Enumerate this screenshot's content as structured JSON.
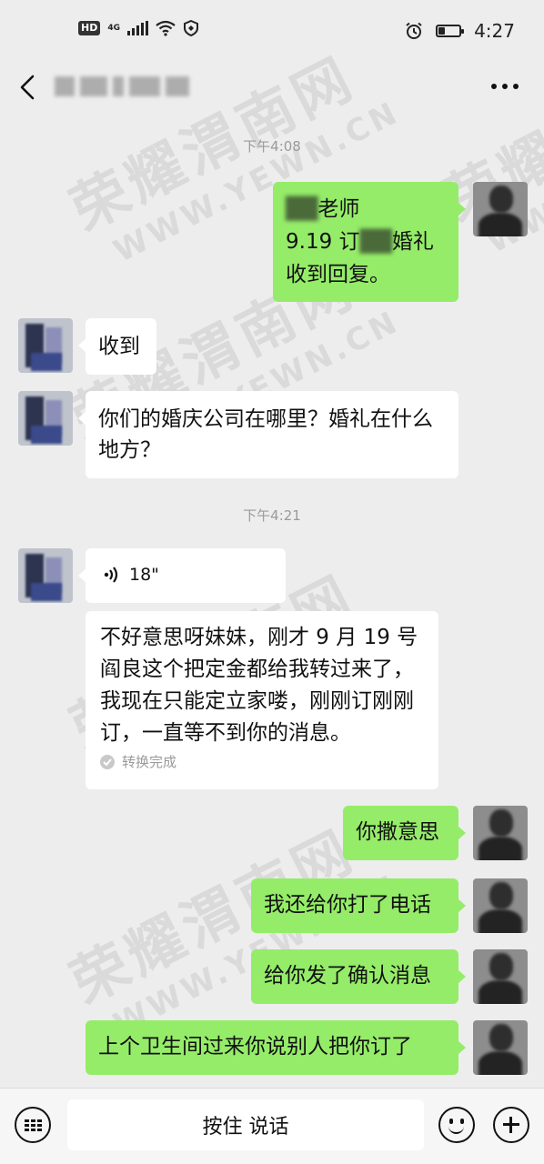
{
  "status_bar": {
    "hd_label": "HD",
    "network_label": "4G",
    "time": "4:27",
    "battery_level": 0.3,
    "icons": [
      "signal-icon",
      "wifi-icon",
      "shield-icon",
      "alarm-icon",
      "battery-icon"
    ]
  },
  "nav": {
    "back_icon": "chevron-left-icon",
    "more_icon": "more-dots-icon"
  },
  "chat": {
    "timestamp_1": "下午4:08",
    "timestamp_2": "下午4:21",
    "msg_self_1": {
      "line1_suffix": "老师",
      "line2_prefix": "9.19 订",
      "line2_suffix": "婚礼",
      "line3": "收到回复。"
    },
    "msg_other_1": "收到",
    "msg_other_2": "你们的婚庆公司在哪里？婚礼在什么地方？",
    "voice": {
      "duration": "18\"",
      "transcript": "不好意思呀妹妹，刚才 9 月 19 号阎良这个把定金都给我转过来了，我现在只能定立家喽，刚刚订刚刚订，一直等不到你的消息。",
      "status": "转换完成"
    },
    "msg_self_2": "你撒意思",
    "msg_self_3": "我还给你打了电话",
    "msg_self_4": "给你发了确认消息",
    "msg_self_5": "上个卫生间过来你说别人把你订了"
  },
  "watermark": {
    "cn": "荣耀渭南网",
    "en": "WWW.YEWN.CN"
  },
  "input_bar": {
    "hold_to_talk": "按住 说话",
    "icons": [
      "keyboard-icon",
      "emoji-icon",
      "plus-icon"
    ]
  }
}
